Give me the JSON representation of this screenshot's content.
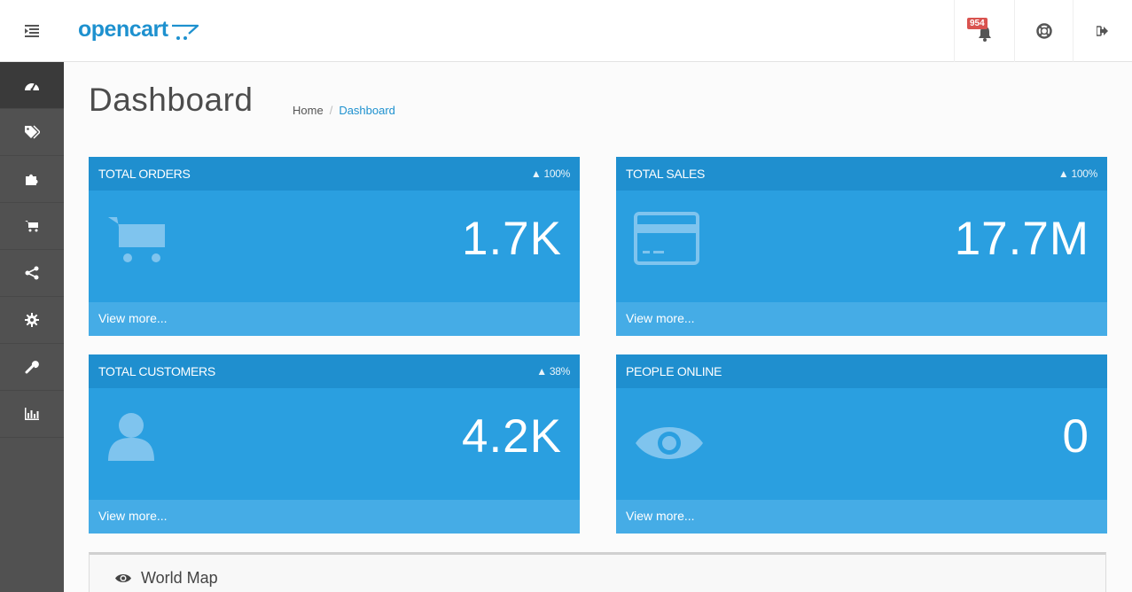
{
  "header": {
    "logo": "opencart",
    "alerts_badge": "954"
  },
  "sidebar": {
    "items": [
      {
        "icon": "dashboard-icon"
      },
      {
        "icon": "tag-icon"
      },
      {
        "icon": "puzzle-icon"
      },
      {
        "icon": "cart-icon"
      },
      {
        "icon": "share-icon"
      },
      {
        "icon": "cog-icon"
      },
      {
        "icon": "wrench-icon"
      },
      {
        "icon": "bar-chart-icon"
      }
    ]
  },
  "page": {
    "title": "Dashboard",
    "breadcrumb": [
      "Home",
      "Dashboard"
    ]
  },
  "tiles": [
    {
      "title": "TOTAL ORDERS",
      "pct": "100%",
      "value": "1.7K",
      "link": "View more...",
      "icon": "shopping-cart-icon"
    },
    {
      "title": "TOTAL SALES",
      "pct": "100%",
      "value": "17.7M",
      "link": "View more...",
      "icon": "credit-card-icon"
    },
    {
      "title": "TOTAL CUSTOMERS",
      "pct": "38%",
      "value": "4.2K",
      "link": "View more...",
      "icon": "user-icon"
    },
    {
      "title": "PEOPLE ONLINE",
      "pct": "",
      "value": "0",
      "link": "View more...",
      "icon": "eye-icon"
    }
  ],
  "world_map": {
    "title": "World Map"
  },
  "colors": {
    "brand": "#1e91cf",
    "tile": "#2a9fe0",
    "sidebar": "#515151"
  }
}
